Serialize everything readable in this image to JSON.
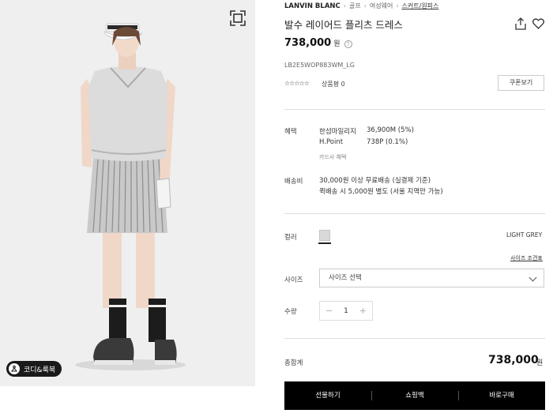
{
  "breadcrumb": {
    "brand": "LANVIN BLANC",
    "items": [
      "골프",
      "여성웨어",
      "스커트/원피스"
    ]
  },
  "product": {
    "title": "발수 레이어드 플리츠 드레스",
    "price": "738,000",
    "price_unit": "원",
    "code": "LB2E5WOP883WM_LG",
    "review_label": "상품평 0",
    "stars": "☆☆☆☆☆",
    "coupon_button": "쿠폰보기"
  },
  "benefits": {
    "label": "혜택",
    "mileage_name": "한섬마일리지",
    "mileage_value": "36,900M (5%)",
    "hpoint_name": "H.Point",
    "hpoint_value": "738P (0.1%)",
    "card_link": "카드사 혜택"
  },
  "shipping": {
    "label": "배송비",
    "line1": "30,000원 이상 무료배송 (실결제 기준)",
    "line2": "퀵배송 시 5,000원 별도 (서울 지역만 가능)"
  },
  "options": {
    "color_label": "컬러",
    "color_name": "LIGHT GREY",
    "swatch_color": "#d9d9d9",
    "size_guide": "사이즈 조견표",
    "size_label": "사이즈",
    "size_placeholder": "사이즈 선택",
    "qty_label": "수량",
    "qty_value": "1",
    "minus": "−",
    "plus": "+"
  },
  "total": {
    "label": "총합계",
    "price": "738,000",
    "unit": "원"
  },
  "actions": {
    "gift": "선물하기",
    "cart": "쇼핑백",
    "buy": "바로구매"
  },
  "gallery": {
    "coordi_button": "코디&룩북"
  }
}
